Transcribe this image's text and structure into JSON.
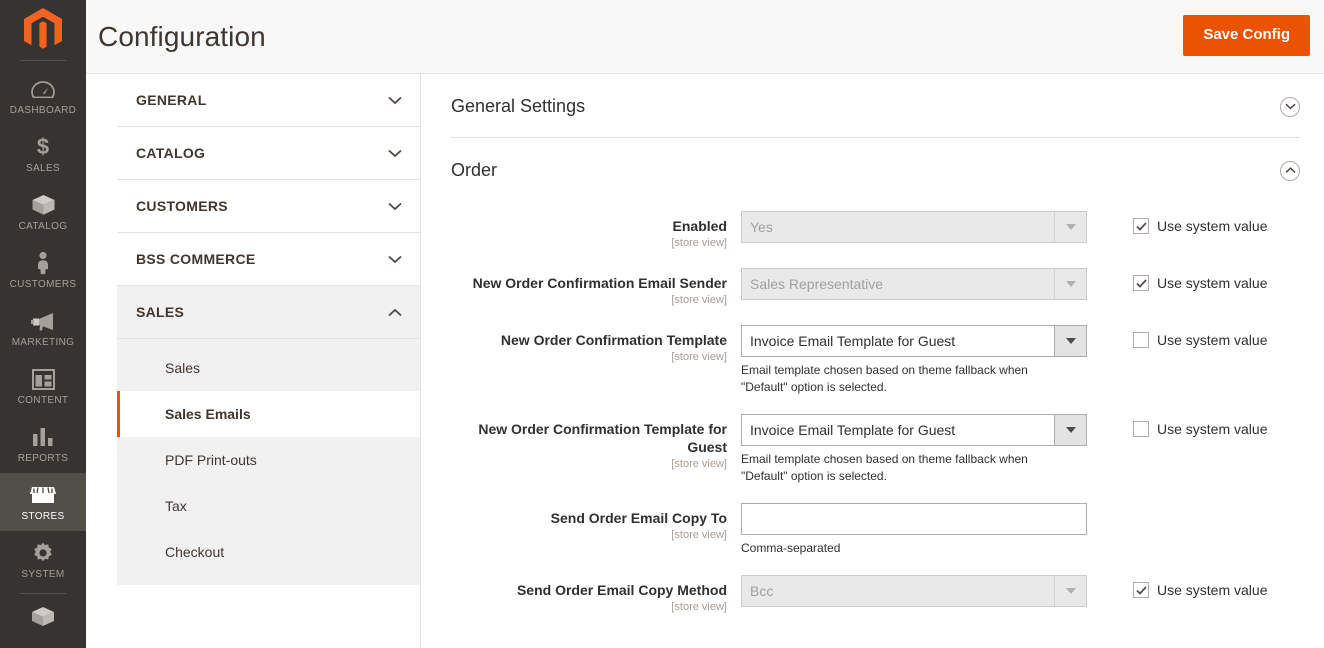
{
  "admin_nav": {
    "logo_alt": "magento-logo",
    "items": [
      {
        "label": "DASHBOARD",
        "icon": "dashboard-icon",
        "active": false
      },
      {
        "label": "SALES",
        "icon": "dollar-icon",
        "active": false
      },
      {
        "label": "CATALOG",
        "icon": "box-icon",
        "active": false
      },
      {
        "label": "CUSTOMERS",
        "icon": "person-icon",
        "active": false
      },
      {
        "label": "MARKETING",
        "icon": "megaphone-icon",
        "active": false
      },
      {
        "label": "CONTENT",
        "icon": "layout-icon",
        "active": false
      },
      {
        "label": "REPORTS",
        "icon": "bar-chart-icon",
        "active": false
      },
      {
        "label": "STORES",
        "icon": "store-icon",
        "active": true
      },
      {
        "label": "SYSTEM",
        "icon": "gear-icon",
        "active": false
      }
    ]
  },
  "header": {
    "title": "Configuration",
    "save_button": "Save Config"
  },
  "config_nav": {
    "sections": [
      {
        "label": "GENERAL",
        "expanded": false
      },
      {
        "label": "CATALOG",
        "expanded": false
      },
      {
        "label": "CUSTOMERS",
        "expanded": false
      },
      {
        "label": "BSS COMMERCE",
        "expanded": false
      },
      {
        "label": "SALES",
        "expanded": true
      }
    ],
    "sales_items": [
      {
        "label": "Sales",
        "active": false
      },
      {
        "label": "Sales Emails",
        "active": true
      },
      {
        "label": "PDF Print-outs",
        "active": false
      },
      {
        "label": "Tax",
        "active": false
      },
      {
        "label": "Checkout",
        "active": false
      }
    ]
  },
  "content": {
    "sections": [
      {
        "title": "General Settings",
        "expanded": false
      },
      {
        "title": "Order",
        "expanded": true
      }
    ],
    "system_value_label": "Use system value",
    "fields": [
      {
        "label": "Enabled",
        "scope": "[store view]",
        "type": "select",
        "value": "Yes",
        "disabled": true,
        "note": "",
        "use_system_value": true,
        "show_system_value": true
      },
      {
        "label": "New Order Confirmation Email Sender",
        "scope": "[store view]",
        "type": "select",
        "value": "Sales Representative",
        "disabled": true,
        "note": "",
        "use_system_value": true,
        "show_system_value": true
      },
      {
        "label": "New Order Confirmation Template",
        "scope": "[store view]",
        "type": "select",
        "value": "Invoice Email Template for Guest",
        "disabled": false,
        "note": "Email template chosen based on theme fallback when \"Default\" option is selected.",
        "use_system_value": false,
        "show_system_value": true
      },
      {
        "label": "New Order Confirmation Template for Guest",
        "scope": "[store view]",
        "type": "select",
        "value": "Invoice Email Template for Guest",
        "disabled": false,
        "note": "Email template chosen based on theme fallback when \"Default\" option is selected.",
        "use_system_value": false,
        "show_system_value": true
      },
      {
        "label": "Send Order Email Copy To",
        "scope": "[store view]",
        "type": "text",
        "value": "",
        "placeholder": "",
        "disabled": false,
        "note": "Comma-separated",
        "use_system_value": false,
        "show_system_value": false
      },
      {
        "label": "Send Order Email Copy Method",
        "scope": "[store view]",
        "type": "select",
        "value": "Bcc",
        "disabled": true,
        "note": "",
        "use_system_value": true,
        "show_system_value": true
      }
    ]
  },
  "colors": {
    "accent": "#eb5202",
    "sidebar_bg": "#373330",
    "sidebar_active": "#524e4a"
  }
}
